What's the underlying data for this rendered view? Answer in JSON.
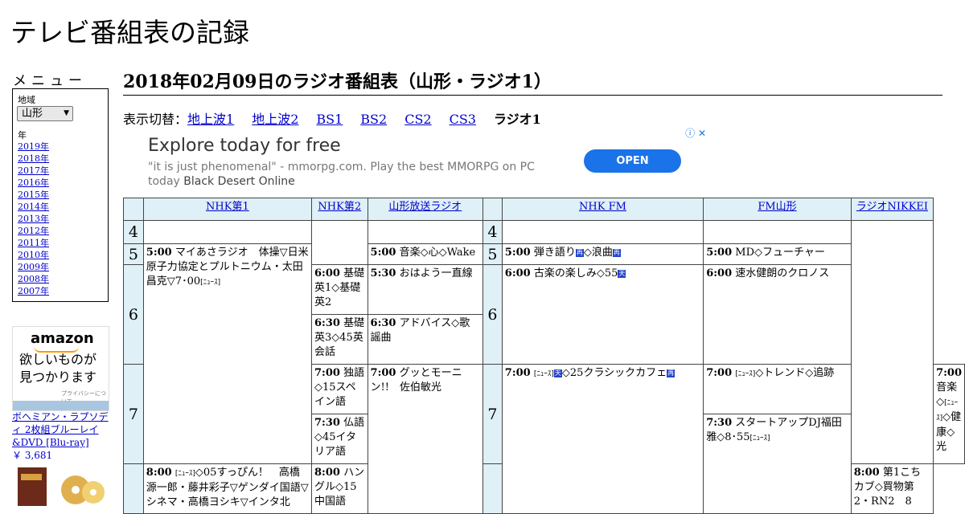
{
  "site": {
    "title": "テレビ番組表の記録"
  },
  "menu": {
    "heading": "メニュー",
    "area_label": "地域",
    "area_value": "山形",
    "year_label": "年",
    "years": [
      "2019年",
      "2018年",
      "2017年",
      "2016年",
      "2015年",
      "2014年",
      "2013年",
      "2012年",
      "2011年",
      "2010年",
      "2009年",
      "2008年",
      "2007年"
    ]
  },
  "amazon_ad": {
    "logo": "amazon",
    "copy": "欲しいものが見つかります",
    "privacy": "プライバシーについて",
    "product": "ボヘミアン・ラプソディ 2枚組ブルーレイ&DVD [Blu-ray]",
    "price": "￥ 3,681"
  },
  "page": {
    "heading": "2018年02月09日のラジオ番組表（山形・ラジオ1）",
    "switch_label": "表示切替：",
    "tabs": [
      "地上波1",
      "地上波2",
      "BS1",
      "BS2",
      "CS2",
      "CS3"
    ],
    "current_tab": "ラジオ1"
  },
  "google_ad": {
    "headline": "Explore today for free",
    "desc": "\"it is just phenomenal\" - mmorpg.com. Play the best MMORPG on PC today",
    "desc_dark": "Black Desert Online",
    "button": "OPEN",
    "adchoices": "ⓘ ✕"
  },
  "grid": {
    "channels": [
      "NHK第1",
      "NHK第2",
      "山形放送ラジオ",
      "NHK FM",
      "FM山形",
      "ラジオNIKKEI"
    ],
    "hours": [
      "4",
      "5",
      "6",
      "7"
    ],
    "programs": {
      "nhk1_500": {
        "time": "5:00",
        "title": "マイあさラジオ　体操▽日米原子力協定とプルトニウム・太田昌克▽7･00",
        "tag": "[ﾆｭｰｽ]"
      },
      "nhk1_800": {
        "time": "8:00",
        "tag": "[ﾆｭｰｽ]",
        "title": "◇05すっぴん！　高橋源一郎・藤井彩子▽ゲンダイ国語▽シネマ・高橋ヨシキ▽インタ北"
      },
      "nhk2_600": {
        "time": "6:00",
        "title": "基礎英1◇基礎英2"
      },
      "nhk2_630": {
        "time": "6:30",
        "title": "基礎英3◇45英会話"
      },
      "nhk2_700": {
        "time": "7:00",
        "title": "独語◇15スペイン語"
      },
      "nhk2_730": {
        "time": "7:30",
        "title": "仏語◇45イタリア語"
      },
      "nhk2_800": {
        "time": "8:00",
        "title": "ハングル◇15中国語"
      },
      "ybc_500": {
        "time": "5:00",
        "title": "音楽◇心◇Wake"
      },
      "ybc_530": {
        "time": "5:30",
        "title": "おはよう一直線"
      },
      "ybc_630": {
        "time": "6:30",
        "title": "アドバイス◇歌謡曲"
      },
      "ybc_700": {
        "time": "7:00",
        "title": "グッとモーニン!!　佐伯敏光"
      },
      "fm_500": {
        "time": "5:00",
        "title": "弾き語り",
        "mark1": "再",
        "mid": "◇浪曲",
        "mark2": "再"
      },
      "fm_600": {
        "time": "6:00",
        "title": "古楽の楽しみ◇55",
        "mark1": "天"
      },
      "fm_700": {
        "time": "7:00",
        "tag": "[ﾆｭｰｽ]",
        "mark1": "天",
        "title": "◇25クラシックカフェ",
        "mark2": "再"
      },
      "fmy_500": {
        "time": "5:00",
        "title": "MD◇フューチャー"
      },
      "fmy_600": {
        "time": "6:00",
        "title": "速水健朗のクロノス"
      },
      "fmy_700": {
        "time": "7:00",
        "tag": "[ﾆｭｰｽ]",
        "title": "◇トレンド◇追跡"
      },
      "fmy_730": {
        "time": "7:30",
        "title": "スタートアップDJ福田雅◇8･55",
        "tag": "[ﾆｭｰｽ]"
      },
      "nikkei_700": {
        "time": "7:00",
        "title": "音楽◇",
        "tag": "[ﾆｭｰｽ]",
        "title2": "◇健康◇光"
      },
      "nikkei_800": {
        "time": "8:00",
        "title": "第1こちカブ◇買物第2・RN2　8"
      }
    }
  },
  "colors": {
    "header_bg": "#dff0f6",
    "link": "#0000cc",
    "ad_button": "#1a73e8"
  }
}
